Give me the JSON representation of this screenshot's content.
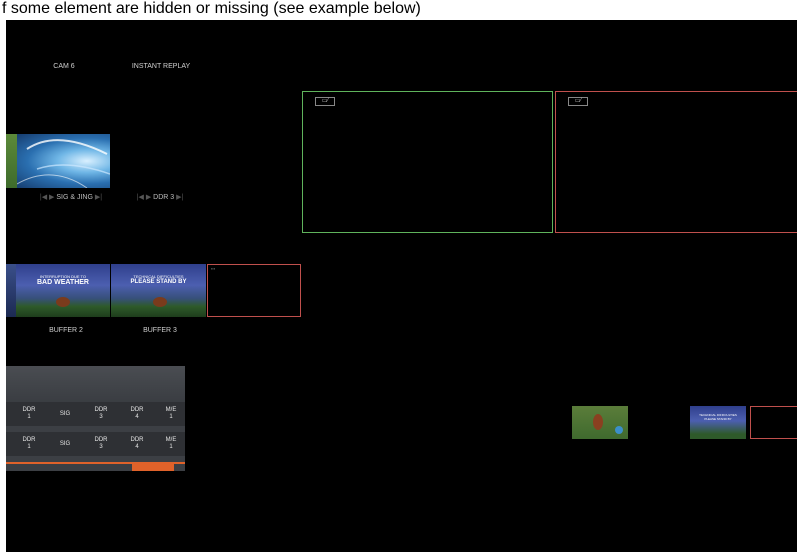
{
  "caption": "f some element are hidden or missing (see example below)",
  "inputs_row1": {
    "cam_label": "CAM 6",
    "replay_label": "INSTANT REPLAY",
    "sig_label": "SIG & JING",
    "ddr_label": "DDR 3"
  },
  "buffers": {
    "buffer2_label": "BUFFER 2",
    "buffer3_label": "BUFFER 3",
    "buffer2_text_top": "INTERRUPTION DUE TO",
    "buffer2_text_main": "BAD WEATHER",
    "buffer3_text_top": "TECHNICAL DIFFICULTIES",
    "buffer3_text_main": "PLEASE STAND BY",
    "empty_frame_label": "▪▪▪"
  },
  "monitors": {
    "preview_icon": "▭⁄",
    "program_icon": "▭⁄",
    "preview_color": "#5fb35c",
    "program_color": "#c0504d"
  },
  "switcher": {
    "row_a": [
      {
        "top": "DDR",
        "bottom": "1"
      },
      {
        "top": "SIG",
        "bottom": ""
      },
      {
        "top": "DDR",
        "bottom": "3"
      },
      {
        "top": "DDR",
        "bottom": "4"
      },
      {
        "top": "M/E",
        "bottom": "1"
      }
    ],
    "row_b": [
      {
        "top": "DDR",
        "bottom": "1"
      },
      {
        "top": "SIG",
        "bottom": ""
      },
      {
        "top": "DDR",
        "bottom": "3"
      },
      {
        "top": "DDR",
        "bottom": "4"
      },
      {
        "top": "M/E",
        "bottom": "1"
      }
    ],
    "accent": "#e0622a"
  },
  "mini_thumbs": {
    "right_thumb_text": "TECHNICAL DIFFICULTIES PLEASE STAND BY"
  }
}
